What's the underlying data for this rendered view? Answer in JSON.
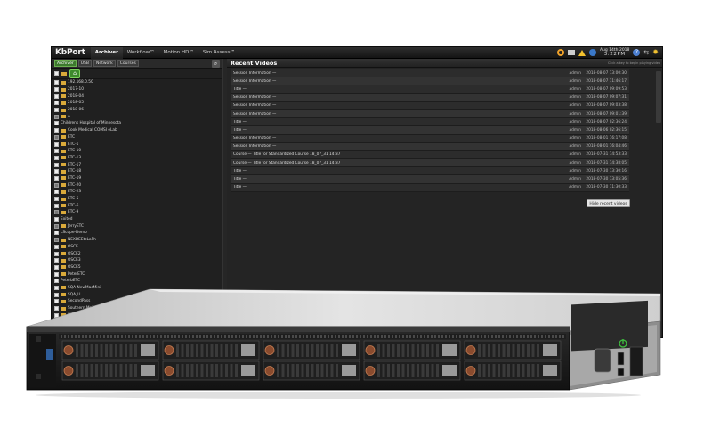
{
  "app": {
    "brand": "KbPort",
    "tabs": [
      {
        "label": "Archiver",
        "active": true
      },
      {
        "label": "Workflow™",
        "active": false
      },
      {
        "label": "Motion HD™",
        "active": false
      },
      {
        "label": "Sim Assess™",
        "active": false
      }
    ],
    "clock": {
      "date": "Aug 14th 2018",
      "time": "3:22PM"
    },
    "status_icons": [
      "ring-icon",
      "printer-icon",
      "warning-icon",
      "info-icon",
      "help-icon",
      "arrows-icon",
      "gear-icon"
    ]
  },
  "left_panel": {
    "toolbar": [
      {
        "label": "Archiver",
        "style": "green"
      },
      {
        "label": "USB",
        "style": "normal"
      },
      {
        "label": "Network",
        "style": "normal"
      },
      {
        "label": "Courses",
        "style": "normal"
      }
    ],
    "tree": [
      {
        "label": "192.168.0.50",
        "checked": true,
        "folder": true
      },
      {
        "label": "2017-10",
        "checked": true,
        "folder": true
      },
      {
        "label": "2018-04",
        "checked": true,
        "folder": true
      },
      {
        "label": "2018-05",
        "checked": true,
        "folder": true
      },
      {
        "label": "2018-06",
        "checked": true,
        "folder": true
      },
      {
        "label": "A",
        "checked": false,
        "folder": true
      },
      {
        "label": "Childrens Hospital of Minnesota",
        "checked": true,
        "folder": false
      },
      {
        "label": "Cook Medical COMSI eLab",
        "checked": true,
        "folder": true
      },
      {
        "label": "ETC",
        "checked": false,
        "folder": true
      },
      {
        "label": "ETC-1",
        "checked": true,
        "folder": true
      },
      {
        "label": "ETC-10",
        "checked": true,
        "folder": true
      },
      {
        "label": "ETC-13",
        "checked": true,
        "folder": true
      },
      {
        "label": "ETC-17",
        "checked": true,
        "folder": true
      },
      {
        "label": "ETC-18",
        "checked": true,
        "folder": true
      },
      {
        "label": "ETC-19",
        "checked": true,
        "folder": true
      },
      {
        "label": "ETC-20",
        "checked": false,
        "folder": true
      },
      {
        "label": "ETC-23",
        "checked": true,
        "folder": true
      },
      {
        "label": "ETC-5",
        "checked": true,
        "folder": true
      },
      {
        "label": "ETC-6",
        "checked": true,
        "folder": true
      },
      {
        "label": "ETC-9",
        "checked": false,
        "folder": true
      },
      {
        "label": "Exited",
        "checked": true,
        "folder": false
      },
      {
        "label": "JerryETC",
        "checked": false,
        "folder": true
      },
      {
        "label": "LScope-Demo",
        "checked": true,
        "folder": false
      },
      {
        "label": "NEXDEEtcLaPh",
        "checked": false,
        "folder": true
      },
      {
        "label": "OSCE",
        "checked": true,
        "folder": true
      },
      {
        "label": "OSCE2",
        "checked": true,
        "folder": true
      },
      {
        "label": "OSCE3",
        "checked": true,
        "folder": true
      },
      {
        "label": "OSCE5",
        "checked": true,
        "folder": true
      },
      {
        "label": "PeterETC",
        "checked": true,
        "folder": true
      },
      {
        "label": "PeterbETC",
        "checked": true,
        "folder": false
      },
      {
        "label": "SQA-NewMacMini",
        "checked": true,
        "folder": true
      },
      {
        "label": "SQA_U",
        "checked": true,
        "folder": true
      },
      {
        "label": "SecondPass",
        "checked": true,
        "folder": true
      },
      {
        "label": "Southern Maine CC",
        "checked": true,
        "folder": true
      },
      {
        "label": "Southern Maine",
        "checked": true,
        "folder": true
      }
    ]
  },
  "recent_videos": {
    "title": "Recent Videos",
    "hint": "Click a key to begin playing video",
    "rows": [
      {
        "title": "Session Information —",
        "user": "admin",
        "date": "2018-08-07 13:00:30"
      },
      {
        "title": "Session Information —",
        "user": "admin",
        "date": "2018-08-07 11:46:17"
      },
      {
        "title": "Title —",
        "user": "admin",
        "date": "2018-08-07 09:09:53"
      },
      {
        "title": "Session Information —",
        "user": "admin",
        "date": "2018-08-07 09:07:31"
      },
      {
        "title": "Session Information —",
        "user": "admin",
        "date": "2018-08-07 09:03:38"
      },
      {
        "title": "Session Information —",
        "user": "admin",
        "date": "2018-08-07 09:01:39"
      },
      {
        "title": "Title —",
        "user": "admin",
        "date": "2018-08-07 02:36:24"
      },
      {
        "title": "Title —",
        "user": "admin",
        "date": "2018-08-06 02:36:15"
      },
      {
        "title": "Session Information —",
        "user": "admin",
        "date": "2018-08-01 16:17:08"
      },
      {
        "title": "Session Information —",
        "user": "admin",
        "date": "2018-08-01 16:04:46"
      },
      {
        "title": "Course — Title for Standardized Course 18_07_31 14:37",
        "user": "admin",
        "date": "2018-07-31 14:53:33"
      },
      {
        "title": "Course — Title for Standardized Course 18_07_31 14:37",
        "user": "admin",
        "date": "2018-07-31 14:38:05"
      },
      {
        "title": "Title —",
        "user": "admin",
        "date": "2018-07-30 13:30:16"
      },
      {
        "title": "Title —",
        "user": "Admin",
        "date": "2018-07-30 13:05:36"
      },
      {
        "title": "Title —",
        "user": "Admin",
        "date": "2018-07-30 11:30:33"
      }
    ],
    "hide_button": "Hide recent videos"
  },
  "colors": {
    "accent_green": "#3d8a2c",
    "folder_yellow": "#d9a93a",
    "server_silver": "#d6d6d6",
    "server_black": "#1a1a1a"
  }
}
